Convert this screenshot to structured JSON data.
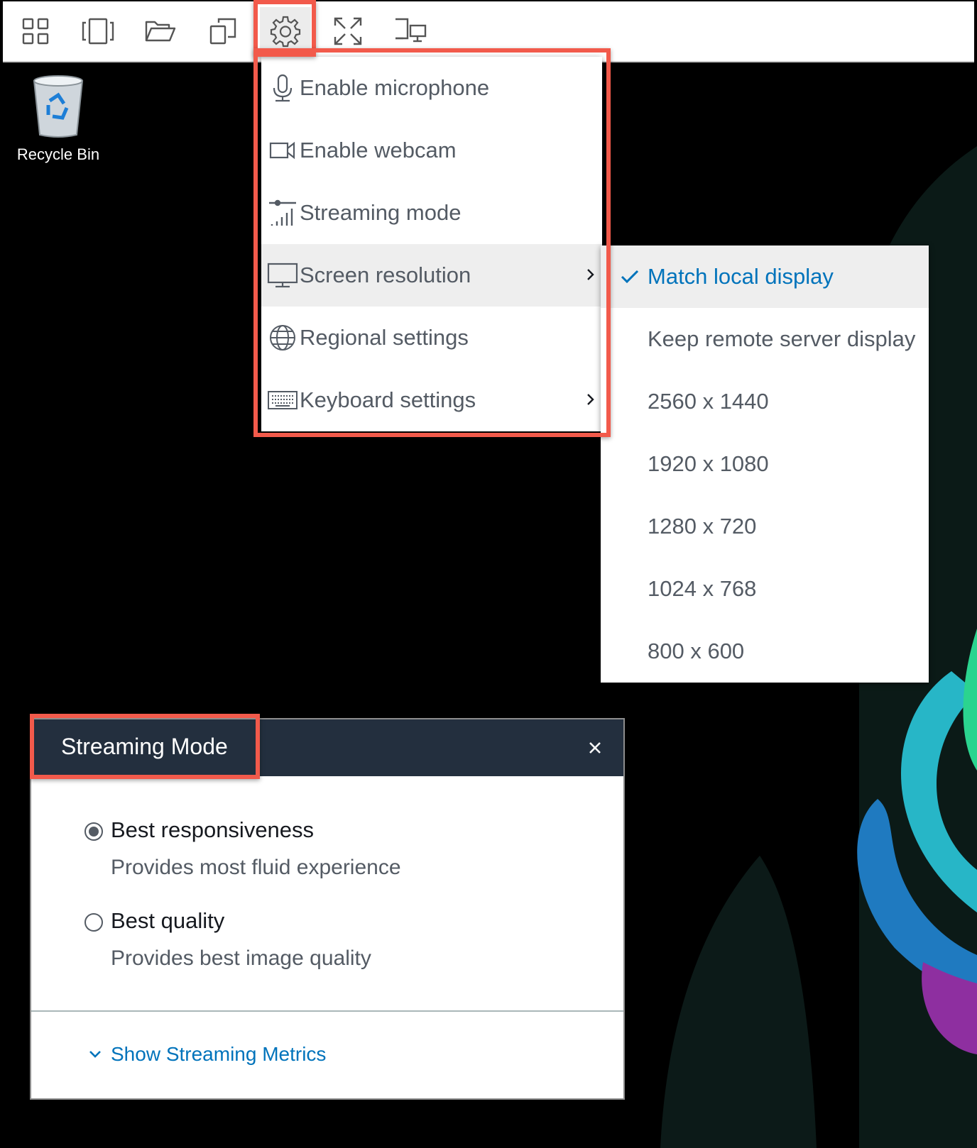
{
  "toolbar": {
    "buttons": [
      {
        "icon": "grid-icon"
      },
      {
        "icon": "window-switch-icon"
      },
      {
        "icon": "folder-icon"
      },
      {
        "icon": "copy-icon"
      },
      {
        "icon": "gear-icon"
      },
      {
        "icon": "fullscreen-icon"
      },
      {
        "icon": "dual-monitor-icon"
      }
    ]
  },
  "desktop": {
    "recycle_bin_label": "Recycle Bin"
  },
  "settings_menu": {
    "items": [
      {
        "label": "Enable microphone",
        "icon": "microphone-icon"
      },
      {
        "label": "Enable webcam",
        "icon": "webcam-icon"
      },
      {
        "label": "Streaming mode",
        "icon": "signal-bars-icon"
      },
      {
        "label": "Screen resolution",
        "icon": "monitor-icon",
        "has_submenu": true,
        "active": true
      },
      {
        "label": "Regional settings",
        "icon": "globe-icon"
      },
      {
        "label": "Keyboard settings",
        "icon": "keyboard-icon",
        "has_submenu": true
      }
    ]
  },
  "resolution_menu": {
    "items": [
      {
        "label": "Match local display",
        "selected": true
      },
      {
        "label": "Keep remote server display"
      },
      {
        "label": "2560 x 1440"
      },
      {
        "label": "1920 x 1080"
      },
      {
        "label": "1280 x 720"
      },
      {
        "label": "1024 x 768"
      },
      {
        "label": "800 x 600"
      }
    ]
  },
  "streaming_dialog": {
    "title": "Streaming Mode",
    "options": [
      {
        "label": "Best responsiveness",
        "description": "Provides most fluid experience",
        "selected": true
      },
      {
        "label": "Best quality",
        "description": "Provides best image quality",
        "selected": false
      }
    ],
    "metrics_toggle_label": "Show Streaming Metrics"
  },
  "colors": {
    "highlight": "#f25a4b",
    "dialog_header": "#232f3e",
    "link": "#0073bb",
    "menu_text": "#545b64"
  }
}
